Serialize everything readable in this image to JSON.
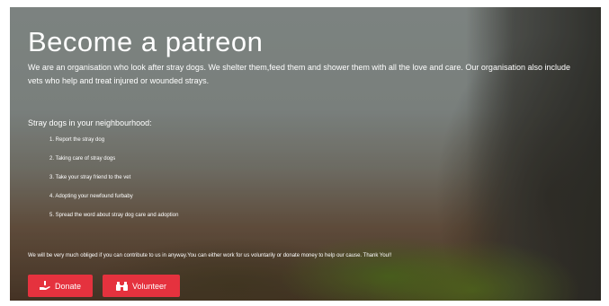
{
  "hero": {
    "title": "Become a patreon",
    "intro": "We are an organisation who look after stray dogs. We shelter them,feed them and shower them with all the love and care. Our organisation also include vets who help and treat injured or wounded strays.",
    "subheading": "Stray dogs in your neighbourhood:",
    "steps": [
      "1. Report the stray dog",
      "2. Taking care of stray dogs",
      "3. Take your stray friend to the vet",
      "4. Adopting your newfound furbaby",
      "5. Spread the word about stray dog care and adoption"
    ],
    "closing": "We will be very much obliged if you can contribute to us in anyway.You can either work for us voluntarily or donate money to help our cause. Thank You!!",
    "buttons": {
      "donate": "Donate",
      "volunteer": "Volunteer"
    },
    "colors": {
      "button": "#e5323e",
      "text": "#ffffff"
    },
    "icons": {
      "donate": "donate-hand-icon",
      "volunteer": "binoculars-icon"
    }
  }
}
